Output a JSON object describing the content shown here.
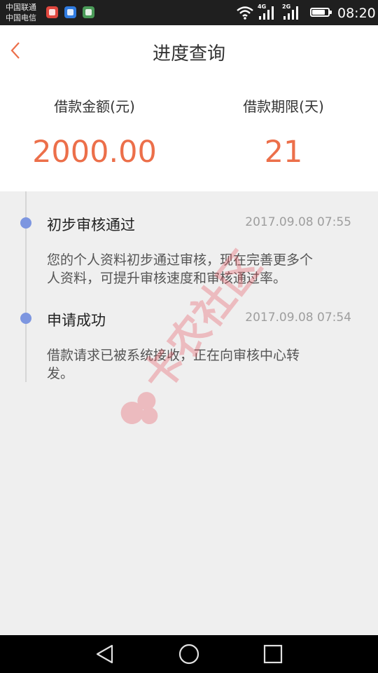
{
  "status_bar": {
    "carrier_1": "中国联通",
    "carrier_2": "中国电信",
    "network_1": "4G",
    "network_2": "2G",
    "battery_level": 0.9,
    "time": "08:20",
    "notification_icons": [
      "mail-app-icon",
      "gallery-app-icon",
      "store-app-icon"
    ]
  },
  "header": {
    "title": "进度查询",
    "back_icon": "chevron-left-icon",
    "accent_color": "#ec6f4a"
  },
  "summary": {
    "amount_label": "借款金额(元)",
    "amount_value": "2000.00",
    "period_label": "借款期限(天)",
    "period_value": "21",
    "value_color": "#ec6f4a"
  },
  "timeline": {
    "dot_color": "#7d96e0",
    "items": [
      {
        "title": "初步审核通过",
        "time": "2017.09.08 07:55",
        "desc_line1": "您的个人资料初步通过审核，现在完善更多个",
        "desc_line2": "人资料，可提升审核速度和审核通过率。"
      },
      {
        "title": "申请成功",
        "time": "2017.09.08 07:54",
        "desc_line1": "借款请求已被系统接收，正在向审核中心转",
        "desc_line2": "发。"
      }
    ]
  },
  "watermark": {
    "text": "卡农社区",
    "color": "#e8505b"
  },
  "nav_bar": {
    "buttons": [
      "back-triangle-icon",
      "home-circle-icon",
      "recents-square-icon"
    ]
  }
}
